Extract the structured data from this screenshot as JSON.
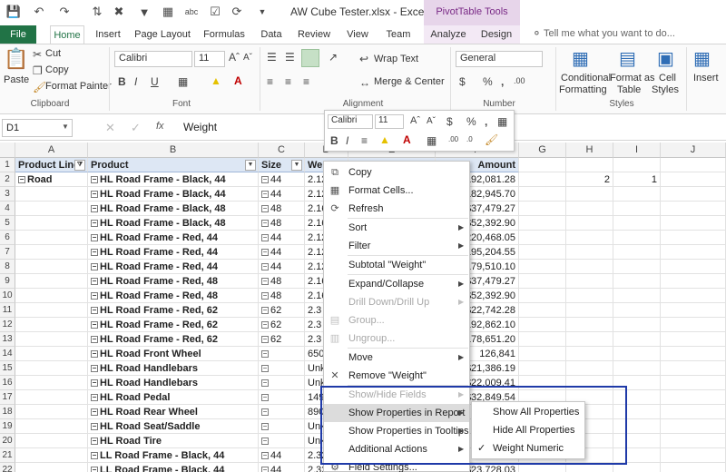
{
  "titlebar": {
    "title": "AW Cube Tester.xlsx - Excel",
    "context_group": "PivotTable Tools"
  },
  "tabs": [
    "File",
    "Home",
    "Insert",
    "Page Layout",
    "Formulas",
    "Data",
    "Review",
    "View",
    "Team",
    "Analyze",
    "Design"
  ],
  "tell_me": "Tell me what you want to do...",
  "ribbon": {
    "clipboard": {
      "paste": "Paste",
      "cut": "Cut",
      "copy": "Copy",
      "format_painter": "Format Painter",
      "label": "Clipboard"
    },
    "font": {
      "name": "Calibri",
      "size": "11",
      "label": "Font",
      "bold": "B",
      "italic": "I",
      "underline": "U"
    },
    "alignment": {
      "wrap": "Wrap Text",
      "merge": "Merge & Center",
      "label": "Alignment"
    },
    "number": {
      "format": "General",
      "currency": "$",
      "percent": "%",
      "comma": ",",
      "label": "Number"
    },
    "styles": {
      "conditional": "Conditional",
      "conditional2": "Formatting",
      "format_as": "Format as",
      "format_as2": "Table",
      "cell": "Cell",
      "cell2": "Styles",
      "label": "Styles"
    },
    "cells": {
      "insert": "Insert",
      "label": ""
    }
  },
  "formula_bar": {
    "namebox": "D1",
    "fx": "fx",
    "value": "Weight"
  },
  "mini_toolbar": {
    "font": "Calibri",
    "size": "11",
    "bold": "B",
    "italic": "I"
  },
  "columns": [
    "A",
    "B",
    "C",
    "D",
    "E",
    "F",
    "G",
    "H",
    "I",
    "J"
  ],
  "rows": [
    {
      "n": "1",
      "a": "Product Line",
      "b": "Product",
      "c": "Size",
      "d": "Weig",
      "f": "Amount"
    },
    {
      "n": "2",
      "a": "Road",
      "b": "HL Road Frame - Black, 44",
      "c": "44",
      "d": "2.12",
      "f": "192,081.28",
      "h": "2",
      "i": "1"
    },
    {
      "n": "3",
      "b": "HL Road Frame - Black, 44",
      "c": "44",
      "d": "2.12",
      "f": "182,945.70"
    },
    {
      "n": "4",
      "b": "HL Road Frame - Black, 48",
      "c": "48",
      "d": "2.16",
      "f": "$37,479.27"
    },
    {
      "n": "5",
      "b": "HL Road Frame - Black, 48",
      "c": "48",
      "d": "2.16",
      "f": "$52,392.90"
    },
    {
      "n": "6",
      "b": "HL Road Frame - Red, 44",
      "c": "44",
      "d": "2.12",
      "f": "220,468.05"
    },
    {
      "n": "7",
      "b": "HL Road Frame - Red, 44",
      "c": "44",
      "d": "2.12",
      "f": "195,204.55"
    },
    {
      "n": "8",
      "b": "HL Road Frame - Red, 44",
      "c": "44",
      "d": "2.12",
      "f": "179,510.10"
    },
    {
      "n": "9",
      "b": "HL Road Frame - Red, 48",
      "c": "48",
      "d": "2.16",
      "f": "$37,479.27"
    },
    {
      "n": "10",
      "b": "HL Road Frame - Red, 48",
      "c": "48",
      "d": "2.16",
      "f": "$52,392.90"
    },
    {
      "n": "11",
      "b": "HL Road Frame - Red, 62",
      "c": "62",
      "d": "2.3",
      "f": "$22,742.28"
    },
    {
      "n": "12",
      "b": "HL Road Frame - Red, 62",
      "c": "62",
      "d": "2.3",
      "f": "192,862.10"
    },
    {
      "n": "13",
      "b": "HL Road Frame - Red, 62",
      "c": "62",
      "d": "2.3",
      "f": "178,651.20"
    },
    {
      "n": "14",
      "b": "HL Road Front Wheel",
      "c": "",
      "d": "650",
      "f": "126,841"
    },
    {
      "n": "15",
      "b": "HL Road Handlebars",
      "c": "",
      "d": "Unk",
      "f": "$21,386.19"
    },
    {
      "n": "16",
      "b": "HL Road Handlebars",
      "c": "",
      "d": "Unk",
      "f": "$22,009.41"
    },
    {
      "n": "17",
      "b": "HL Road Pedal",
      "c": "",
      "d": "149",
      "f": "$32,849.54"
    },
    {
      "n": "18",
      "b": "HL Road Rear Wheel",
      "c": "",
      "d": "890",
      "f": ""
    },
    {
      "n": "19",
      "b": "HL Road Seat/Saddle",
      "c": "",
      "d": "Unk",
      "f": ""
    },
    {
      "n": "20",
      "b": "HL Road Tire",
      "c": "",
      "d": "Unk",
      "f": ""
    },
    {
      "n": "21",
      "b": "LL Road Frame - Black, 44",
      "c": "44",
      "d": "2.32",
      "f": ""
    },
    {
      "n": "22",
      "b": "LL Road Frame - Black, 44",
      "c": "44",
      "d": "2.32",
      "f": "$23,728.03"
    }
  ],
  "context_menu": [
    {
      "label": "Copy",
      "icon": "copy-icon"
    },
    {
      "label": "Format Cells...",
      "icon": "format-cells-icon"
    },
    {
      "label": "Refresh",
      "icon": "refresh-icon"
    },
    {
      "label": "Sort",
      "arrow": true
    },
    {
      "label": "Filter",
      "arrow": true
    },
    {
      "label": "Subtotal \"Weight\""
    },
    {
      "label": "Expand/Collapse",
      "arrow": true
    },
    {
      "label": "Drill Down/Drill Up",
      "arrow": true,
      "disabled": true
    },
    {
      "label": "Group...",
      "icon": "group-icon",
      "disabled": true
    },
    {
      "label": "Ungroup...",
      "icon": "ungroup-icon",
      "disabled": true
    },
    {
      "label": "Move",
      "arrow": true
    },
    {
      "label": "Remove \"Weight\"",
      "icon": "remove-icon"
    },
    {
      "label": "Show/Hide Fields",
      "arrow": true,
      "disabled": true
    },
    {
      "label": "Show Properties in Report",
      "arrow": true,
      "highlighted": true
    },
    {
      "label": "Show Properties in Tooltips",
      "arrow": true
    },
    {
      "label": "Additional Actions",
      "arrow": true
    },
    {
      "label": "Field Settings...",
      "icon": "field-settings-icon"
    }
  ],
  "submenu": [
    {
      "label": "Show All Properties"
    },
    {
      "label": "Hide All Properties"
    },
    {
      "label": "Weight Numeric",
      "checked": true
    }
  ],
  "colors": {
    "excel_green": "#217346",
    "context_purple": "#7a2a86",
    "annotation_blue": "#1f3aa8"
  }
}
